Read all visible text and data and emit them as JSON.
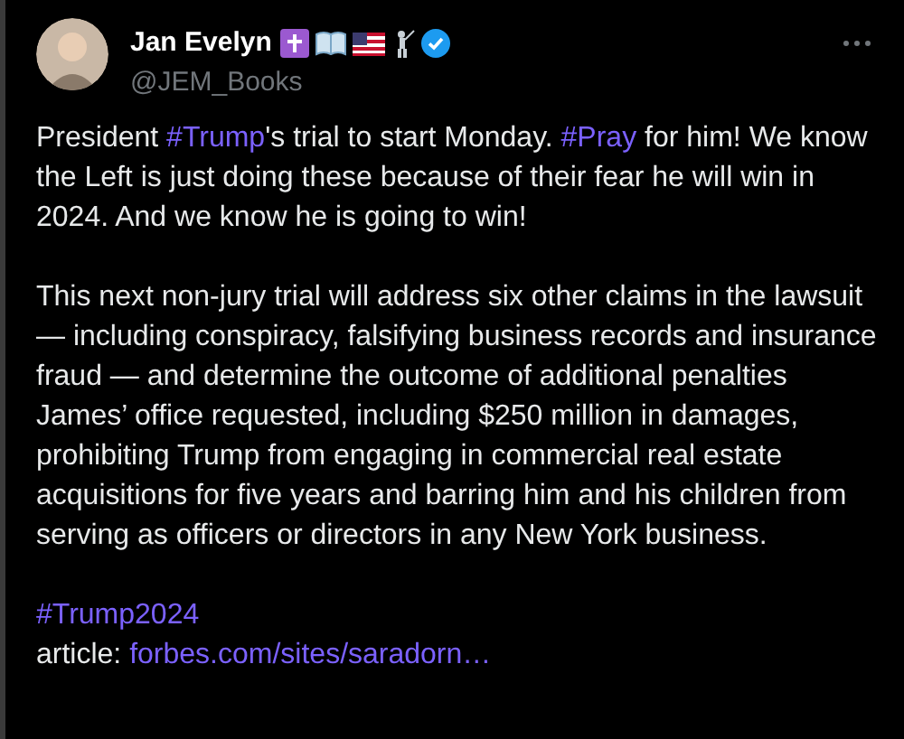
{
  "author": {
    "name": "Jan Evelyn",
    "handle": "@JEM_Books",
    "verified": true
  },
  "body": [
    {
      "kind": "paragraph",
      "parts": [
        {
          "kind": "text",
          "text": "President "
        },
        {
          "kind": "hashtag",
          "text": "#Trump"
        },
        {
          "kind": "text",
          "text": "'s trial to start Monday. "
        },
        {
          "kind": "hashtag",
          "text": "#Pray"
        },
        {
          "kind": "text",
          "text": " for him! We know the Left is just doing these because of their fear he will win in 2024. And we know he is going to win!"
        }
      ]
    },
    {
      "kind": "paragraph",
      "parts": [
        {
          "kind": "text",
          "text": "This next non-jury trial will address six other claims in the lawsuit — including conspiracy, falsifying business records and insurance fraud — and determine the outcome of additional penalties James’ office requested, including $250 million in damages, prohibiting Trump from engaging in commercial real estate acquisitions for five years and barring him and his children from serving as officers or directors in any New York business."
        }
      ]
    },
    {
      "kind": "line",
      "parts": [
        {
          "kind": "hashtag",
          "text": "#Trump2024"
        }
      ]
    },
    {
      "kind": "line",
      "parts": [
        {
          "kind": "text",
          "text": "article: "
        },
        {
          "kind": "link",
          "text": "forbes.com/sites/saradorn…"
        }
      ]
    }
  ]
}
